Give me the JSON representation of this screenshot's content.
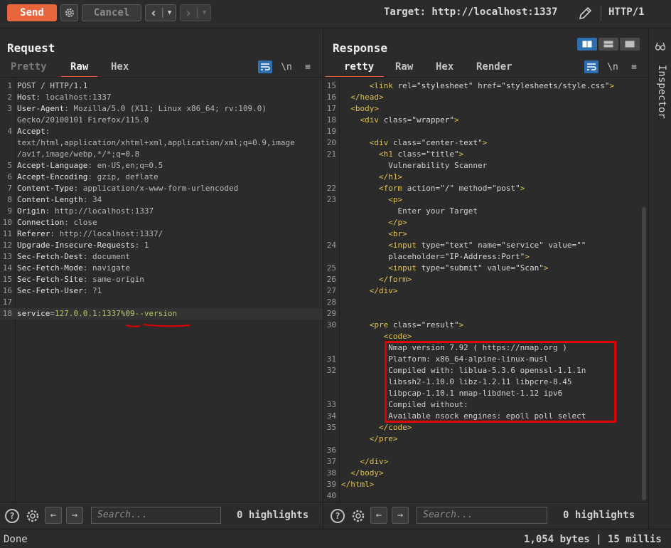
{
  "toolbar": {
    "send_label": "Send",
    "cancel_label": "Cancel",
    "target_label": "Target: http://localhost:1337",
    "protocol_label": "HTTP/1"
  },
  "request": {
    "title": "Request",
    "tabs": [
      "Pretty",
      "Raw",
      "Hex"
    ],
    "active_tab": "Raw",
    "newline_toggle": "\\n",
    "lines": [
      {
        "n": "1",
        "parts": [
          [
            "plain",
            "POST / HTTP/1.1"
          ]
        ]
      },
      {
        "n": "2",
        "parts": [
          [
            "k",
            "Host"
          ],
          [
            "v",
            ": localhost:1337"
          ]
        ]
      },
      {
        "n": "3",
        "parts": [
          [
            "k",
            "User-Agent"
          ],
          [
            "v",
            ": Mozilla/5.0 (X11; Linux x86_64; rv:109.0)"
          ]
        ]
      },
      {
        "n": "",
        "parts": [
          [
            "v",
            "Gecko/20100101 Firefox/115.0"
          ]
        ]
      },
      {
        "n": "4",
        "parts": [
          [
            "k",
            "Accept"
          ],
          [
            "v",
            ":"
          ]
        ]
      },
      {
        "n": "",
        "parts": [
          [
            "v",
            "text/html,application/xhtml+xml,application/xml;q=0.9,image"
          ]
        ]
      },
      {
        "n": "",
        "parts": [
          [
            "v",
            "/avif,image/webp,*/*;q=0.8"
          ]
        ]
      },
      {
        "n": "5",
        "parts": [
          [
            "k",
            "Accept-Language"
          ],
          [
            "v",
            ": en-US,en;q=0.5"
          ]
        ]
      },
      {
        "n": "6",
        "parts": [
          [
            "k",
            "Accept-Encoding"
          ],
          [
            "v",
            ": gzip, deflate"
          ]
        ]
      },
      {
        "n": "7",
        "parts": [
          [
            "k",
            "Content-Type"
          ],
          [
            "v",
            ": application/x-www-form-urlencoded"
          ]
        ]
      },
      {
        "n": "8",
        "parts": [
          [
            "k",
            "Content-Length"
          ],
          [
            "v",
            ": 34"
          ]
        ]
      },
      {
        "n": "9",
        "parts": [
          [
            "k",
            "Origin"
          ],
          [
            "v",
            ": http://localhost:1337"
          ]
        ]
      },
      {
        "n": "10",
        "parts": [
          [
            "k",
            "Connection"
          ],
          [
            "v",
            ": close"
          ]
        ]
      },
      {
        "n": "11",
        "parts": [
          [
            "k",
            "Referer"
          ],
          [
            "v",
            ": http://localhost:1337/"
          ]
        ]
      },
      {
        "n": "12",
        "parts": [
          [
            "k",
            "Upgrade-Insecure-Requests"
          ],
          [
            "v",
            ": 1"
          ]
        ]
      },
      {
        "n": "13",
        "parts": [
          [
            "k",
            "Sec-Fetch-Dest"
          ],
          [
            "v",
            ": document"
          ]
        ]
      },
      {
        "n": "14",
        "parts": [
          [
            "k",
            "Sec-Fetch-Mode"
          ],
          [
            "v",
            ": navigate"
          ]
        ]
      },
      {
        "n": "15",
        "parts": [
          [
            "k",
            "Sec-Fetch-Site"
          ],
          [
            "v",
            ": same-origin"
          ]
        ]
      },
      {
        "n": "16",
        "parts": [
          [
            "k",
            "Sec-Fetch-User"
          ],
          [
            "v",
            ": ?1"
          ]
        ]
      },
      {
        "n": "17",
        "parts": []
      },
      {
        "n": "18",
        "parts": [
          [
            "k",
            "service"
          ],
          [
            "v",
            "="
          ],
          [
            "green",
            "127.0.0.1:1337%09--version"
          ]
        ]
      }
    ],
    "search_placeholder": "Search...",
    "highlights": "0 highlights"
  },
  "response": {
    "title": "Response",
    "tabs": [
      "retty",
      "Raw",
      "Hex",
      "Render"
    ],
    "active_tab": "retty",
    "newline_toggle": "\\n",
    "lines": [
      {
        "n": "15",
        "parts": [
          [
            "plain",
            "      "
          ],
          [
            "tg",
            "<link "
          ],
          [
            "at",
            "rel="
          ],
          [
            "st",
            "\"stylesheet\" "
          ],
          [
            "at",
            "href="
          ],
          [
            "st",
            "\"stylesheets/style.css\""
          ],
          [
            "tg",
            ">"
          ]
        ]
      },
      {
        "n": "16",
        "parts": [
          [
            "plain",
            "  "
          ],
          [
            "tg",
            "</head>"
          ]
        ]
      },
      {
        "n": "17",
        "parts": [
          [
            "plain",
            "  "
          ],
          [
            "tg",
            "<body>"
          ]
        ]
      },
      {
        "n": "18",
        "parts": [
          [
            "plain",
            "    "
          ],
          [
            "tg",
            "<div "
          ],
          [
            "at",
            "class="
          ],
          [
            "st",
            "\"wrapper\""
          ],
          [
            "tg",
            ">"
          ]
        ]
      },
      {
        "n": "19",
        "parts": []
      },
      {
        "n": "20",
        "parts": [
          [
            "plain",
            "      "
          ],
          [
            "tg",
            "<div "
          ],
          [
            "at",
            "class="
          ],
          [
            "st",
            "\"center-text\""
          ],
          [
            "tg",
            ">"
          ]
        ]
      },
      {
        "n": "21",
        "parts": [
          [
            "plain",
            "        "
          ],
          [
            "tg",
            "<h1 "
          ],
          [
            "at",
            "class="
          ],
          [
            "st",
            "\"title\""
          ],
          [
            "tg",
            ">"
          ]
        ]
      },
      {
        "n": "",
        "parts": [
          [
            "plain",
            "          Vulnerability Scanner"
          ]
        ]
      },
      {
        "n": "",
        "parts": [
          [
            "plain",
            "        "
          ],
          [
            "tg",
            "</h1>"
          ]
        ]
      },
      {
        "n": "22",
        "parts": [
          [
            "plain",
            "        "
          ],
          [
            "tg",
            "<form "
          ],
          [
            "at",
            "action="
          ],
          [
            "st",
            "\"/\" "
          ],
          [
            "at",
            "method="
          ],
          [
            "st",
            "\"post\""
          ],
          [
            "tg",
            ">"
          ]
        ]
      },
      {
        "n": "23",
        "parts": [
          [
            "plain",
            "          "
          ],
          [
            "tg",
            "<p>"
          ]
        ]
      },
      {
        "n": "",
        "parts": [
          [
            "plain",
            "            Enter your Target"
          ]
        ]
      },
      {
        "n": "",
        "parts": [
          [
            "plain",
            "          "
          ],
          [
            "tg",
            "</p>"
          ]
        ]
      },
      {
        "n": "",
        "parts": [
          [
            "plain",
            "          "
          ],
          [
            "tg",
            "<br>"
          ]
        ]
      },
      {
        "n": "24",
        "parts": [
          [
            "plain",
            "          "
          ],
          [
            "tg",
            "<input "
          ],
          [
            "at",
            "type="
          ],
          [
            "st",
            "\"text\" "
          ],
          [
            "at",
            "name="
          ],
          [
            "st",
            "\"service\" "
          ],
          [
            "at",
            "value="
          ],
          [
            "st",
            "\"\""
          ]
        ]
      },
      {
        "n": "",
        "parts": [
          [
            "plain",
            "          "
          ],
          [
            "at",
            "placeholder="
          ],
          [
            "st",
            "\"IP-Address:Port\""
          ],
          [
            "tg",
            ">"
          ]
        ]
      },
      {
        "n": "25",
        "parts": [
          [
            "plain",
            "          "
          ],
          [
            "tg",
            "<input "
          ],
          [
            "at",
            "type="
          ],
          [
            "st",
            "\"submit\" "
          ],
          [
            "at",
            "value="
          ],
          [
            "st",
            "\"Scan\""
          ],
          [
            "tg",
            ">"
          ]
        ]
      },
      {
        "n": "26",
        "parts": [
          [
            "plain",
            "        "
          ],
          [
            "tg",
            "</form>"
          ]
        ]
      },
      {
        "n": "27",
        "parts": [
          [
            "plain",
            "      "
          ],
          [
            "tg",
            "</div>"
          ]
        ]
      },
      {
        "n": "28",
        "parts": []
      },
      {
        "n": "29",
        "parts": []
      },
      {
        "n": "30",
        "parts": [
          [
            "plain",
            "      "
          ],
          [
            "tg",
            "<pre "
          ],
          [
            "at",
            "class="
          ],
          [
            "st",
            "\"result\""
          ],
          [
            "tg",
            ">"
          ]
        ]
      },
      {
        "n": "",
        "parts": [
          [
            "plain",
            "         "
          ],
          [
            "tg",
            "<code>"
          ]
        ]
      },
      {
        "n": "",
        "parts": [
          [
            "plain",
            "          Nmap version 7.92 ( https://nmap.org )"
          ]
        ]
      },
      {
        "n": "31",
        "parts": [
          [
            "plain",
            "          Platform: x86_64-alpine-linux-musl"
          ]
        ]
      },
      {
        "n": "32",
        "parts": [
          [
            "plain",
            "          Compiled with: liblua-5.3.6 openssl-1.1.1n"
          ]
        ]
      },
      {
        "n": "",
        "parts": [
          [
            "plain",
            "          libssh2-1.10.0 libz-1.2.11 libpcre-8.45"
          ]
        ]
      },
      {
        "n": "",
        "parts": [
          [
            "plain",
            "          libpcap-1.10.1 nmap-libdnet-1.12 ipv6"
          ]
        ]
      },
      {
        "n": "33",
        "parts": [
          [
            "plain",
            "          Compiled without:"
          ]
        ]
      },
      {
        "n": "34",
        "parts": [
          [
            "plain",
            "          Available nsock engines: epoll poll select"
          ]
        ]
      },
      {
        "n": "35",
        "parts": [
          [
            "plain",
            "        "
          ],
          [
            "tg",
            "</code>"
          ]
        ]
      },
      {
        "n": "",
        "parts": [
          [
            "plain",
            "      "
          ],
          [
            "tg",
            "</pre>"
          ]
        ]
      },
      {
        "n": "36",
        "parts": []
      },
      {
        "n": "37",
        "parts": [
          [
            "plain",
            "    "
          ],
          [
            "tg",
            "</div>"
          ]
        ]
      },
      {
        "n": "38",
        "parts": [
          [
            "plain",
            "  "
          ],
          [
            "tg",
            "</body>"
          ]
        ]
      },
      {
        "n": "39",
        "parts": [
          [
            "tg",
            "</html>"
          ]
        ]
      },
      {
        "n": "40",
        "parts": []
      }
    ],
    "search_placeholder": "Search...",
    "highlights": "0 highlights"
  },
  "inspector": {
    "label": "Inspector"
  },
  "status": {
    "left": "Done",
    "right": "1,054 bytes | 15 millis"
  },
  "colors": {
    "accent": "#e8663d",
    "highlight_box": "#e00000",
    "toggle_blue": "#2f6fb0"
  }
}
